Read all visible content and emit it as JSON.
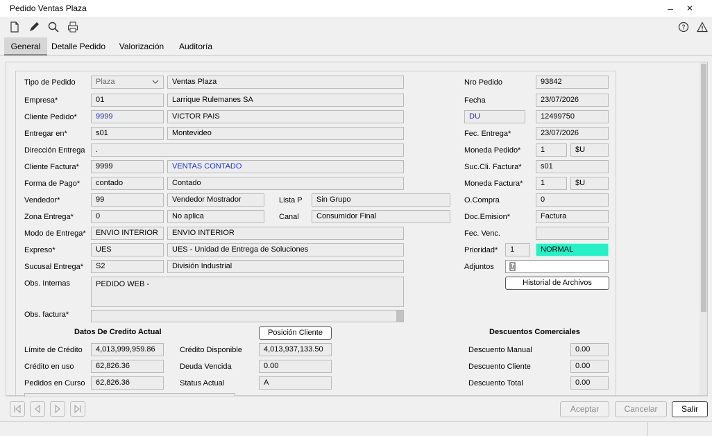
{
  "window": {
    "title": "Pedido Ventas Plaza",
    "minimize": "–",
    "close": "✕"
  },
  "toolbar": {
    "icons": [
      "new-document-icon",
      "edit-pencil-icon",
      "search-icon",
      "print-icon",
      "help-icon",
      "warning-icon"
    ]
  },
  "tabs": [
    "General",
    "Detalle Pedido",
    "Valorización",
    "Auditoría"
  ],
  "form": {
    "tipo_pedido": {
      "label": "Tipo de Pedido",
      "code": "Plaza",
      "desc": "Ventas Plaza"
    },
    "empresa": {
      "label": "Empresa*",
      "code": "01",
      "desc": "Larrique Rulemanes SA"
    },
    "cliente_pedido": {
      "label": "Cliente Pedido*",
      "code": "9999",
      "desc": "VICTOR PAIS"
    },
    "entregar_en": {
      "label": "Entregar en*",
      "code": "s01",
      "desc": "Montevideo"
    },
    "direccion_entrega": {
      "label": "Dirección Entrega",
      "value": "."
    },
    "cliente_factura": {
      "label": "Cliente Factura*",
      "code": "9999",
      "desc": "VENTAS CONTADO"
    },
    "forma_pago": {
      "label": "Forma de Pago*",
      "code": "contado",
      "desc": "Contado"
    },
    "vendedor": {
      "label": "Vendedor*",
      "code": "99",
      "desc": "Vendedor Mostrador"
    },
    "lista_p": {
      "label": "Lista P",
      "value": "Sin Grupo"
    },
    "zona_entrega": {
      "label": "Zona Entrega*",
      "code": "0",
      "desc": "No aplica"
    },
    "canal": {
      "label": "Canal",
      "value": "Consumidor Final"
    },
    "modo_entrega": {
      "label": "Modo de Entrega*",
      "code": "ENVIO INTERIOR",
      "desc": "ENVIO INTERIOR"
    },
    "expreso": {
      "label": "Expreso*",
      "code": "UES",
      "desc": "UES  - Unidad de Entrega de Soluciones"
    },
    "sucursal_entrega": {
      "label": "Sucusal Entrega*",
      "code": "S2",
      "desc": "División Industrial"
    },
    "obs_internas": {
      "label": "Obs. Internas",
      "value": "PEDIDO WEB -"
    },
    "obs_factura": {
      "label": "Obs. factura*",
      "value": ""
    }
  },
  "right": {
    "nro_pedido": {
      "label": "Nro Pedido",
      "value": "93842"
    },
    "fecha": {
      "label": "Fecha",
      "value": "23/07/2026"
    },
    "doc": {
      "type": "DU",
      "value": "12499750"
    },
    "fec_entrega": {
      "label": "Fec. Entrega*",
      "value": "23/07/2026"
    },
    "moneda_pedido": {
      "label": "Moneda Pedido*",
      "code": "1",
      "symbol": "$U"
    },
    "suc_cli_factura": {
      "label": "Suc.Cli. Factura*",
      "value": "s01"
    },
    "moneda_factura": {
      "label": "Moneda Factura*",
      "code": "1",
      "symbol": "$U"
    },
    "o_compra": {
      "label": "O.Compra",
      "value": "0"
    },
    "doc_emision": {
      "label": "Doc.Emision*",
      "value": "Factura"
    },
    "fec_venc": {
      "label": "Fec. Venc.",
      "value": ""
    },
    "prioridad": {
      "label": "Prioridad*",
      "code": "1",
      "desc": "NORMAL"
    },
    "adjuntos": {
      "label": "Adjuntos",
      "value": ""
    },
    "historial_button": "Historial de Archivos"
  },
  "credito": {
    "title": "Datos De Credito Actual",
    "posicion_button": "Posición Cliente",
    "limite": {
      "label": "Límite de Crédito",
      "value": "4,013,999,959.86"
    },
    "en_uso": {
      "label": "Crédito en uso",
      "value": "62,826.36"
    },
    "pedidos_curso": {
      "label": "Pedidos en Curso",
      "value": "62,826.36"
    },
    "disponible": {
      "label": "Crédito Disponible",
      "value": "4,013,937,133.50"
    },
    "deuda_vencida": {
      "label": "Deuda Vencida",
      "value": "0.00"
    },
    "status": {
      "label": "Status Actual",
      "value": "A"
    }
  },
  "descuentos": {
    "title": "Descuentos Comerciales",
    "manual": {
      "label": "Descuento Manual",
      "value": "0.00"
    },
    "cliente": {
      "label": "Descuento Cliente",
      "value": "0.00"
    },
    "total": {
      "label": "Descuento Total",
      "value": "0.00"
    }
  },
  "footer": {
    "nav_icons": [
      "first-record-icon",
      "previous-record-icon",
      "next-record-icon",
      "last-record-icon"
    ],
    "aceptar": "Aceptar",
    "cancelar": "Cancelar",
    "salir": "Salir"
  },
  "colors": {
    "link_blue": "#1a2fc8",
    "priority_teal": "#27f0c8"
  }
}
